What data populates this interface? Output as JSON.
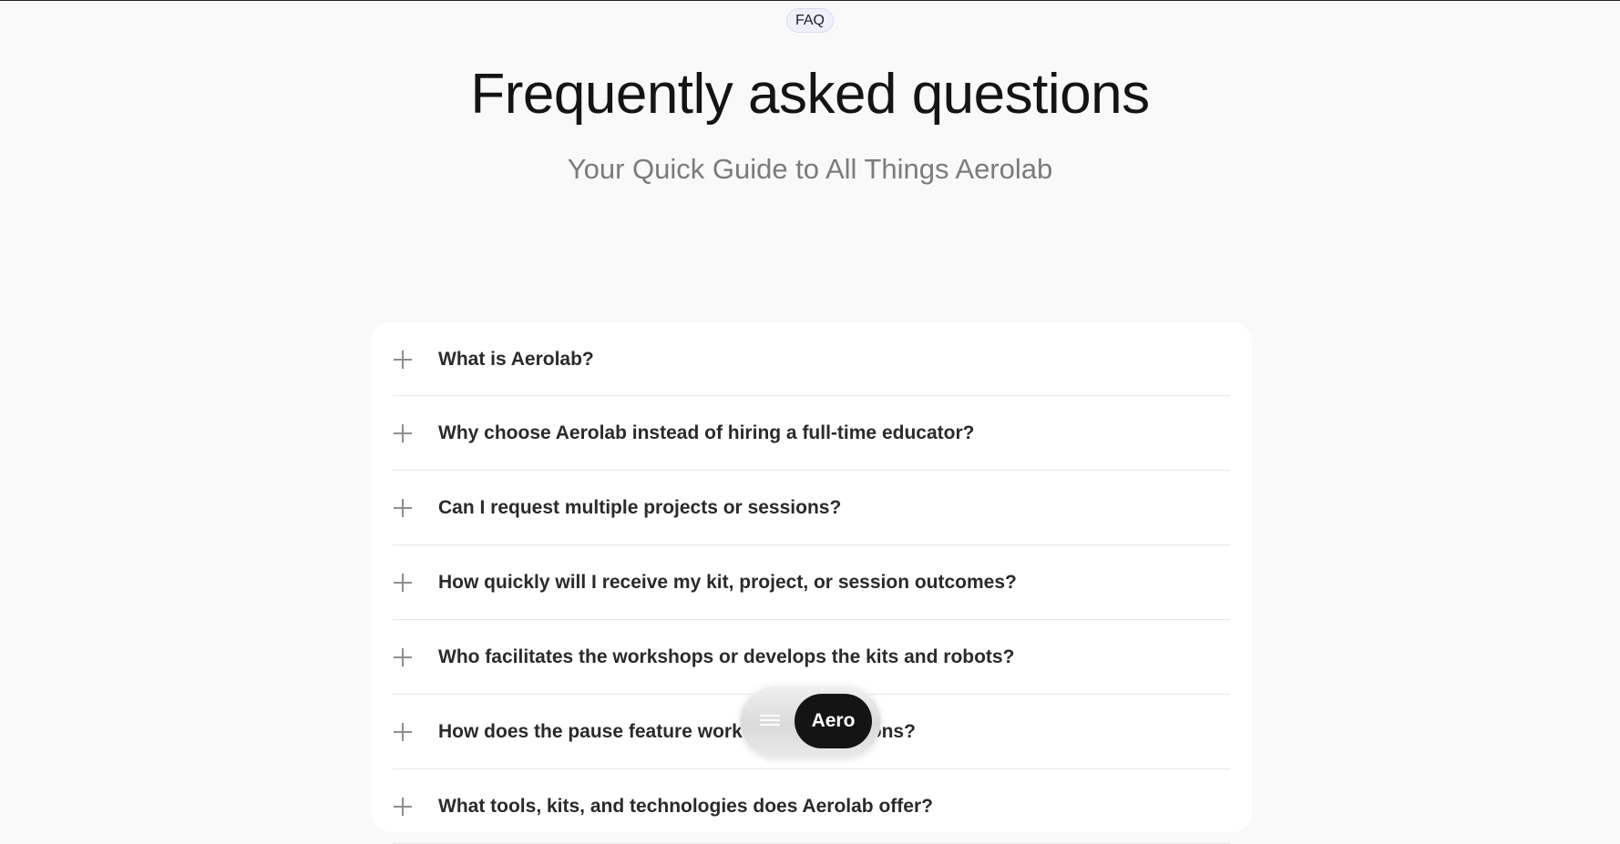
{
  "badge": "FAQ",
  "title": "Frequently asked questions",
  "subtitle": "Your Quick Guide to All Things Aerolab",
  "faq": [
    {
      "question": "What is Aerolab?",
      "icon": "plus-icon"
    },
    {
      "question": "Why choose Aerolab instead of hiring a full-time educator?",
      "icon": "plus-icon"
    },
    {
      "question": "Can I request multiple projects or sessions?",
      "icon": "plus-icon"
    },
    {
      "question": "How quickly will I receive my kit, project, or session outcomes?",
      "icon": "plus-icon"
    },
    {
      "question": "Who facilitates the workshops or develops the kits and robots?",
      "icon": "plus-icon"
    },
    {
      "question": "How does the pause feature work for subscriptions?",
      "icon": "plus-icon"
    },
    {
      "question": "What tools, kits, and technologies does Aerolab offer?",
      "icon": "plus-icon"
    }
  ],
  "floating_nav": {
    "menu_icon": "hamburger-menu-icon",
    "brand_button": "Aero"
  },
  "colors": {
    "background": "#f9f9f9",
    "card": "#ffffff",
    "badge_bg": "#eef0fb",
    "brand_button": "#141414"
  }
}
